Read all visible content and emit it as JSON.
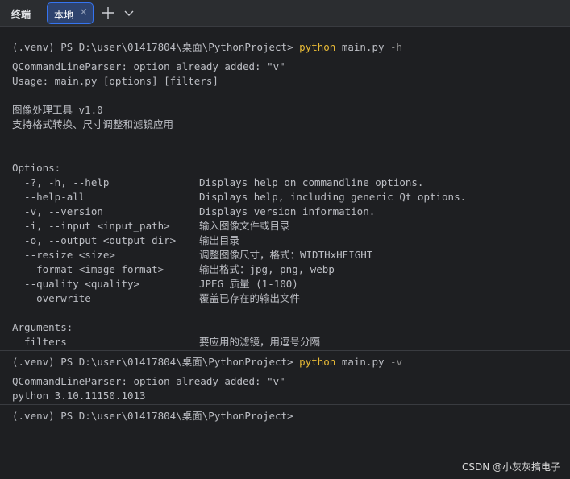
{
  "tabbar": {
    "tool_title": "终端",
    "tab_label": "本地",
    "tab_close": "×",
    "add_tab": "+"
  },
  "session1": {
    "prompt": "(.venv) PS D:\\user\\01417804\\桌面\\PythonProject> ",
    "cmd": "python",
    "script": " main.py ",
    "arg": "-h",
    "output": [
      "QCommandLineParser: option already added: \"v\"",
      "Usage: main.py [options] [filters]",
      "",
      "图像处理工具 v1.0",
      "支持格式转换、尺寸调整和滤镜应用",
      "",
      "",
      "Options:"
    ],
    "options": [
      {
        "name": "  -?, -h, --help",
        "desc": "Displays help on commandline options."
      },
      {
        "name": "  --help-all",
        "desc": "Displays help, including generic Qt options."
      },
      {
        "name": "  -v, --version",
        "desc": "Displays version information."
      },
      {
        "name": "  -i, --input <input_path>",
        "desc": "输入图像文件或目录"
      },
      {
        "name": "  -o, --output <output_dir>",
        "desc": "输出目录"
      },
      {
        "name": "  --resize <size>",
        "desc": "调整图像尺寸，格式：WIDTHxHEIGHT"
      },
      {
        "name": "  --format <image_format>",
        "desc": "输出格式：jpg, png, webp"
      },
      {
        "name": "  --quality <quality>",
        "desc": "JPEG 质量 (1-100)"
      },
      {
        "name": "  --overwrite",
        "desc": "覆盖已存在的输出文件"
      }
    ],
    "arguments_header": "Arguments:",
    "arguments": [
      {
        "name": "  filters",
        "desc": "要应用的滤镜，用逗号分隔"
      }
    ]
  },
  "session2": {
    "prompt": "(.venv) PS D:\\user\\01417804\\桌面\\PythonProject> ",
    "cmd": "python",
    "script": " main.py ",
    "arg": "-v",
    "output": [
      "QCommandLineParser: option already added: \"v\"",
      "python 3.10.11150.1013"
    ]
  },
  "session3": {
    "prompt": "(.venv) PS D:\\user\\01417804\\桌面\\PythonProject>"
  },
  "watermark": "CSDN @小灰灰搞电子",
  "colors": {
    "background": "#1e1f22",
    "text": "#bcbec4",
    "command": "#e8ba36",
    "tab_active": "#2e436e"
  }
}
